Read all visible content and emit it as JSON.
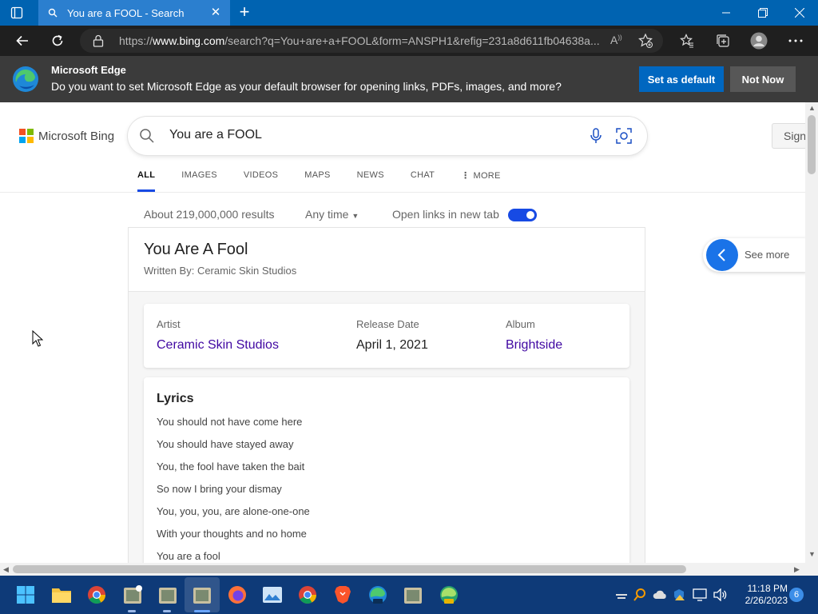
{
  "browser": {
    "tab_title": "You are a FOOL - Search",
    "url_prefix": "https://",
    "url_host": "www.bing.com",
    "url_rest": "/search?q=You+are+a+FOOL&form=ANSPH1&refig=231a8d611fb04638a..."
  },
  "infobar": {
    "title": "Microsoft Edge",
    "message": "Do you want to set Microsoft Edge as your default browser for opening links, PDFs, images, and more?",
    "set_default": "Set as default",
    "not_now": "Not Now"
  },
  "bing": {
    "logo_text": "Microsoft Bing",
    "query": "You are a FOOL",
    "signin": "Sign",
    "tabs": [
      "ALL",
      "IMAGES",
      "VIDEOS",
      "MAPS",
      "NEWS",
      "CHAT",
      "MORE"
    ],
    "results_count": "About 219,000,000 results",
    "any_time": "Any time",
    "open_links": "Open links in new tab",
    "see_more": "See more"
  },
  "song": {
    "title": "You Are A Fool",
    "written_by": "Written By: Ceramic Skin Studios",
    "artist_label": "Artist",
    "artist": "Ceramic Skin Studios",
    "release_label": "Release Date",
    "release_date": "April 1, 2021",
    "album_label": "Album",
    "album": "Brightside",
    "lyrics_heading": "Lyrics",
    "lyrics": [
      "You should not have come here",
      "You should have stayed away",
      "You, the fool have taken the bait",
      "So now I bring your dismay",
      "You, you, you, are alone-one-one",
      "With your thoughts and no home",
      "You are a fool"
    ]
  },
  "taskbar": {
    "time": "11:18 PM",
    "date": "2/26/2023",
    "notifications": "6"
  },
  "colors": {
    "titlebar": "#0063b1",
    "accent_blue": "#174ae4",
    "link_purple": "#4007a2",
    "taskbar": "#0e3a78"
  }
}
